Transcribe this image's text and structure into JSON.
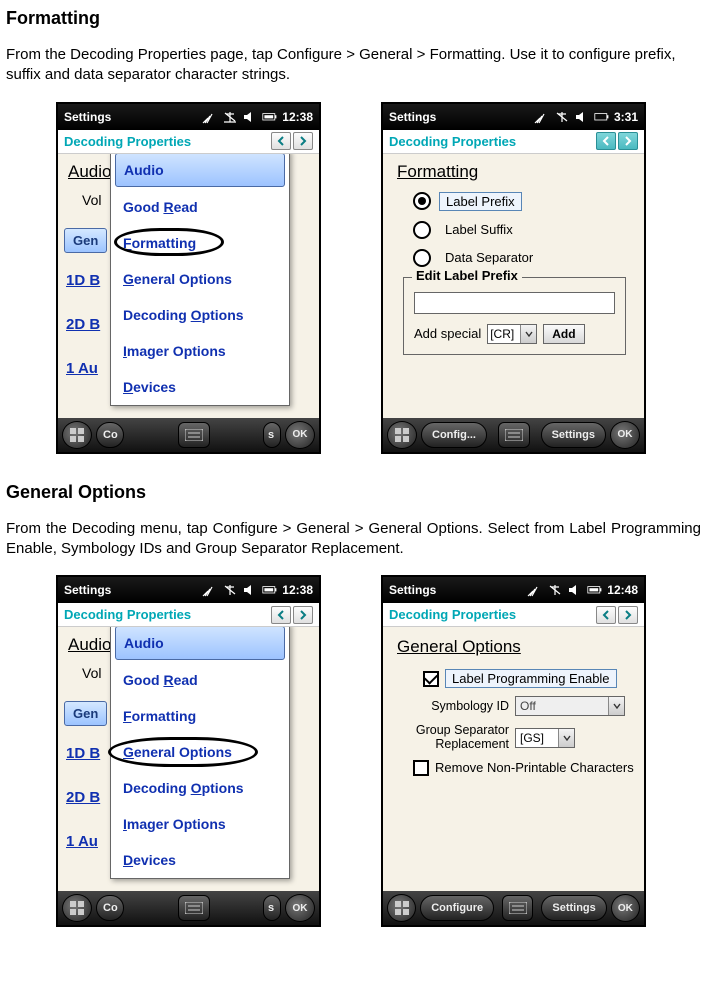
{
  "section1": {
    "heading": "Formatting",
    "paragraph": "From the Decoding Properties page, tap Configure > General > Formatting. Use it to configure prefix, suffix and data separator character strings."
  },
  "section2": {
    "heading": "General Options",
    "paragraph": "From the Decoding menu, tap Configure > General > General Options. Select from Label Programming Enable, Symbology IDs and Group Separator Replacement."
  },
  "screens": {
    "menu1": {
      "title": "Settings",
      "clock": "12:38",
      "subheader": "Decoding Properties",
      "back_audio": "Audio",
      "back_vol": "Vol",
      "back_gen": "Gen",
      "back_1d": "1D B",
      "back_2d": "2D B",
      "back_1au": "1 Au",
      "menu": {
        "audio": "Audio",
        "goodread_pre": "Good ",
        "goodread_u": "R",
        "goodread_post": "ead",
        "formatting_u": "F",
        "formatting_post": "ormatting",
        "genopt_u": "G",
        "genopt_post": "eneral Options",
        "decopt_pre": "Decoding ",
        "decopt_u": "O",
        "decopt_post": "ptions",
        "imager_u": "I",
        "imager_post": "mager Options",
        "devices_u": "D",
        "devices_post": "evices"
      },
      "bb_left": "Co",
      "bb_right": "s",
      "bb_ok": "OK"
    },
    "fmt": {
      "title": "Settings",
      "clock": "3:31",
      "subheader": "Decoding Properties",
      "heading": "Formatting",
      "r1": "Label Prefix",
      "r2": "Label Suffix",
      "r3": "Data Separator",
      "fieldset_legend": "Edit Label Prefix",
      "add_special": "Add special",
      "select_val": "[CR]",
      "add_btn": "Add",
      "bb_left": "Config...",
      "bb_right": "Settings",
      "bb_ok": "OK"
    },
    "go": {
      "title": "Settings",
      "clock": "12:48",
      "subheader": "Decoding Properties",
      "heading": "General Options",
      "cb1": "Label Programming Enable",
      "lab_symid": "Symbology ID",
      "val_symid": "Off",
      "lab_gs1": "Group Separator",
      "lab_gs2": "Replacement",
      "val_gs": "[GS]",
      "cb2": "Remove Non-Printable Characters",
      "bb_left": "Configure",
      "bb_right": "Settings",
      "bb_ok": "OK"
    }
  }
}
